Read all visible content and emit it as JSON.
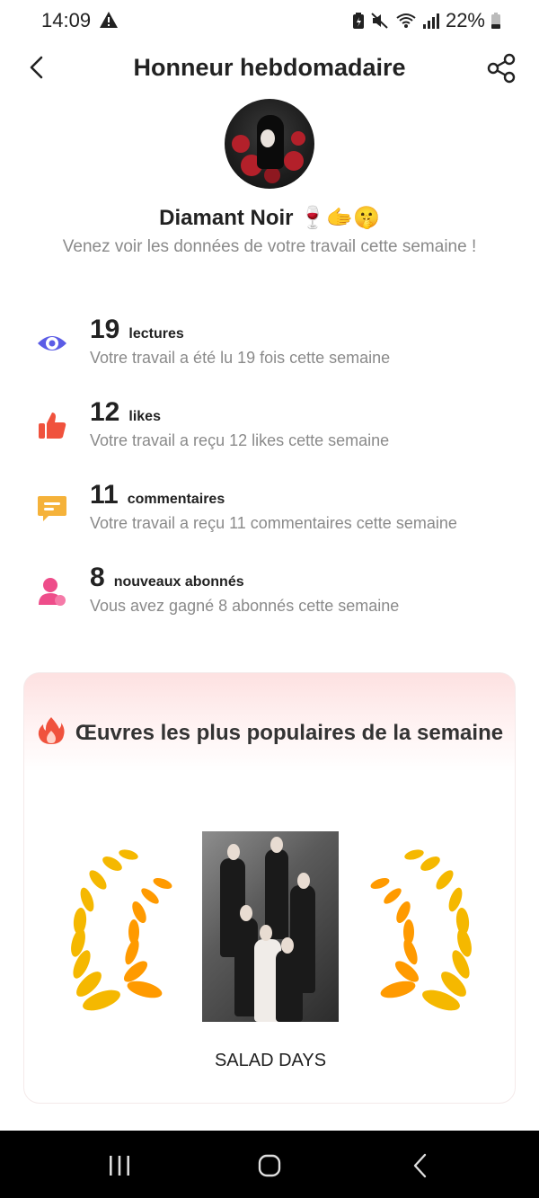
{
  "status_bar": {
    "time": "14:09",
    "battery": "22%"
  },
  "header": {
    "title": "Honneur hebdomadaire"
  },
  "profile": {
    "name": "Diamant Noir 🍷🫱🤫",
    "subtitle": "Venez voir les données de votre travail cette semaine !"
  },
  "stats": [
    {
      "value": "19",
      "label": "lectures",
      "description": "Votre travail a été lu 19 fois cette semaine",
      "icon": "eye-icon",
      "color": "#5b5ce6"
    },
    {
      "value": "12",
      "label": "likes",
      "description": "Votre travail a reçu 12 likes cette semaine",
      "icon": "thumbs-up-icon",
      "color": "#f0523d"
    },
    {
      "value": "11",
      "label": "commentaires",
      "description": "Votre travail a reçu 11 commentaires cette semaine",
      "icon": "comment-icon",
      "color": "#f5b23a"
    },
    {
      "value": "8",
      "label": "nouveaux abonnés",
      "description": "Vous avez gagné 8 abonnés cette semaine",
      "icon": "user-icon",
      "color": "#ee4d8a"
    }
  ],
  "popular": {
    "title": "Œuvres les plus populaires de la semaine",
    "book_title": "SALAD DAYS"
  },
  "colors": {
    "card_gradient_top": "#fde1e1",
    "laurel_gold": "#f5b800",
    "laurel_orange": "#ff8a00"
  }
}
